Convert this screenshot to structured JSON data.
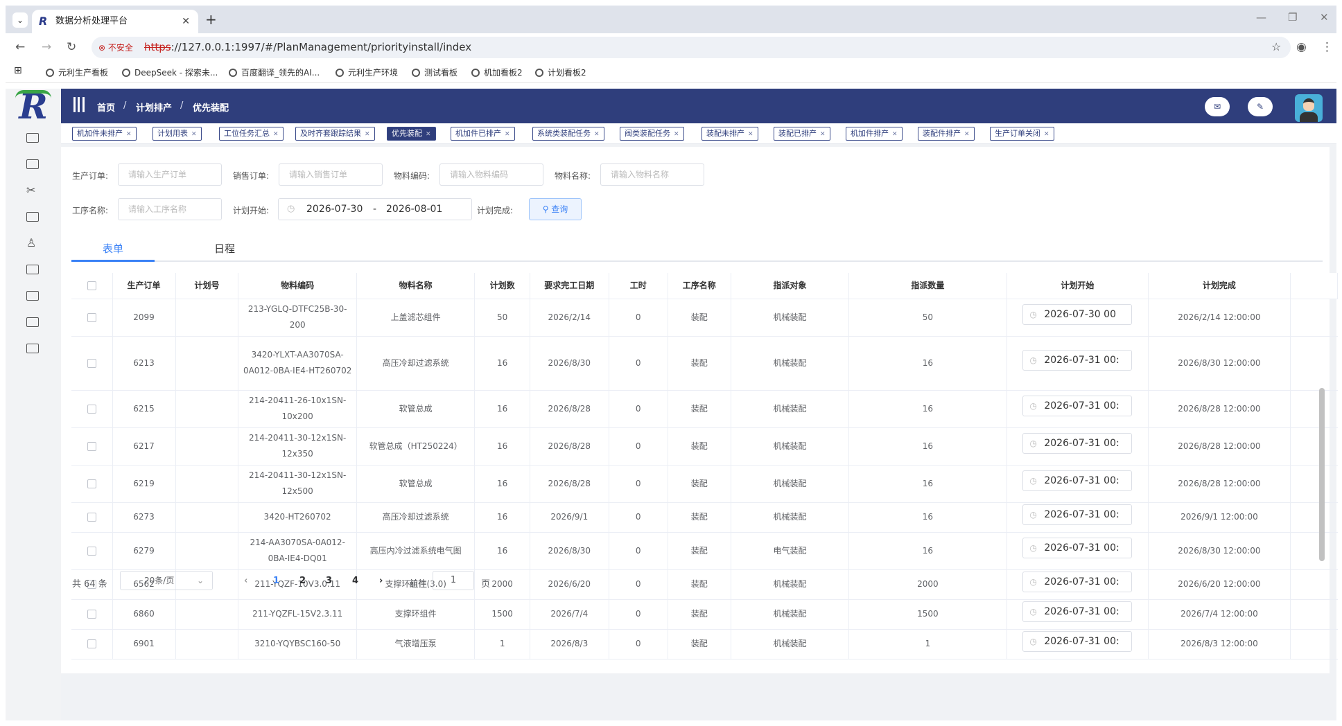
{
  "browser": {
    "tab_title": "数据分析处理平台",
    "insecure_label": "不安全",
    "url_proto": "https",
    "url_rest": "://127.0.0.1:1997/#/PlanManagement/priorityinstall/index",
    "bookmarks": [
      "元利生产看板",
      "DeepSeek - 探索未...",
      "百度翻译_领先的AI...",
      "元利生产环境",
      "测试看板",
      "机加看板2",
      "计划看板2"
    ]
  },
  "header": {
    "breadcrumb": [
      "首页",
      "计划排产",
      "优先装配"
    ],
    "separator": "/"
  },
  "tags": [
    {
      "label": "机加件未排产",
      "active": false
    },
    {
      "label": "计划用表",
      "active": false
    },
    {
      "label": "工位任务汇总",
      "active": false
    },
    {
      "label": "及时齐套跟踪结果",
      "active": false
    },
    {
      "label": "优先装配",
      "active": true
    },
    {
      "label": "机加件已排产",
      "active": false
    },
    {
      "label": "系统类装配任务",
      "active": false
    },
    {
      "label": "阀类装配任务",
      "active": false
    },
    {
      "label": "装配未排产",
      "active": false
    },
    {
      "label": "装配已排产",
      "active": false
    },
    {
      "label": "机加件排产",
      "active": false
    },
    {
      "label": "装配件排产",
      "active": false
    },
    {
      "label": "生产订单关闭",
      "active": false
    }
  ],
  "filters": {
    "prod_order": {
      "label": "生产订单:",
      "placeholder": "请输入生产订单"
    },
    "sales_order": {
      "label": "销售订单:",
      "placeholder": "请输入销售订单"
    },
    "material_code": {
      "label": "物料编码:",
      "placeholder": "请输入物料编码"
    },
    "material_name": {
      "label": "物料名称:",
      "placeholder": "请输入物料名称"
    },
    "process_name": {
      "label": "工序名称:",
      "placeholder": "请输入工序名称"
    },
    "plan_start": {
      "label": "计划开始:",
      "from": "2026-07-30",
      "sep": "-",
      "to": "2026-08-01"
    },
    "plan_finish": {
      "label": "计划完成:"
    },
    "query_label": "查询"
  },
  "view_tabs": [
    "表单",
    "日程"
  ],
  "table": {
    "headers": [
      "生产订单",
      "计划号",
      "物料编码",
      "物料名称",
      "计划数",
      "要求完工日期",
      "工时",
      "工序名称",
      "指派对象",
      "指派数量",
      "计划开始",
      "计划完成"
    ],
    "rows": [
      [
        "2099",
        "",
        "213-YGLQ-DTFC25B-30-200",
        "上盖滤芯组件",
        "50",
        "2026/2/14",
        "0",
        "装配",
        "机械装配",
        "50",
        "2026-07-30 00",
        "2026/2/14 12:00:00"
      ],
      [
        "6213",
        "",
        "3420-YLXT-AA3070SA-0A012-0BA-IE4-HT260702",
        "高压冷却过滤系统",
        "16",
        "2026/8/30",
        "0",
        "装配",
        "机械装配",
        "16",
        "2026-07-31 00:",
        "2026/8/30 12:00:00"
      ],
      [
        "6215",
        "",
        "214-20411-26-10x1SN-10x200",
        "软管总成",
        "16",
        "2026/8/28",
        "0",
        "装配",
        "机械装配",
        "16",
        "2026-07-31 00:",
        "2026/8/28 12:00:00"
      ],
      [
        "6217",
        "",
        "214-20411-30-12x1SN-12x350",
        "软管总成（HT250224）",
        "16",
        "2026/8/28",
        "0",
        "装配",
        "机械装配",
        "16",
        "2026-07-31 00:",
        "2026/8/28 12:00:00"
      ],
      [
        "6219",
        "",
        "214-20411-30-12x1SN-12x500",
        "软管总成",
        "16",
        "2026/8/28",
        "0",
        "装配",
        "机械装配",
        "16",
        "2026-07-31 00:",
        "2026/8/28 12:00:00"
      ],
      [
        "6273",
        "",
        "3420-HT260702",
        "高压冷却过滤系统",
        "16",
        "2026/9/1",
        "0",
        "装配",
        "机械装配",
        "16",
        "2026-07-31 00:",
        "2026/9/1 12:00:00"
      ],
      [
        "6279",
        "",
        "214-AA3070SA-0A012-0BA-IE4-DQ01",
        "高压内冷过滤系统电气图",
        "16",
        "2026/8/30",
        "0",
        "装配",
        "电气装配",
        "16",
        "2026-07-31 00:",
        "2026/8/30 12:00:00"
      ],
      [
        "6562",
        "",
        "211-YQZF-10V3.0.11",
        "支撑环组件(3.0)",
        "2000",
        "2026/6/20",
        "0",
        "装配",
        "机械装配",
        "2000",
        "2026-07-31 00:",
        "2026/6/20 12:00:00"
      ],
      [
        "6860",
        "",
        "211-YQZFL-15V2.3.11",
        "支撑环组件",
        "1500",
        "2026/7/4",
        "0",
        "装配",
        "机械装配",
        "1500",
        "2026-07-31 00:",
        "2026/7/4 12:00:00"
      ],
      [
        "6901",
        "",
        "3210-YQYBSC160-50",
        "气液增压泵",
        "1",
        "2026/8/3",
        "0",
        "装配",
        "机械装配",
        "1",
        "2026-07-31 00:",
        "2026/8/3 12:00:00"
      ]
    ]
  },
  "pagination": {
    "total": "共 64 条",
    "page_size": "20条/页",
    "pages": [
      "1",
      "2",
      "3",
      "4"
    ],
    "goto_label": "前往",
    "goto_value": "1",
    "goto_suffix": "页"
  }
}
